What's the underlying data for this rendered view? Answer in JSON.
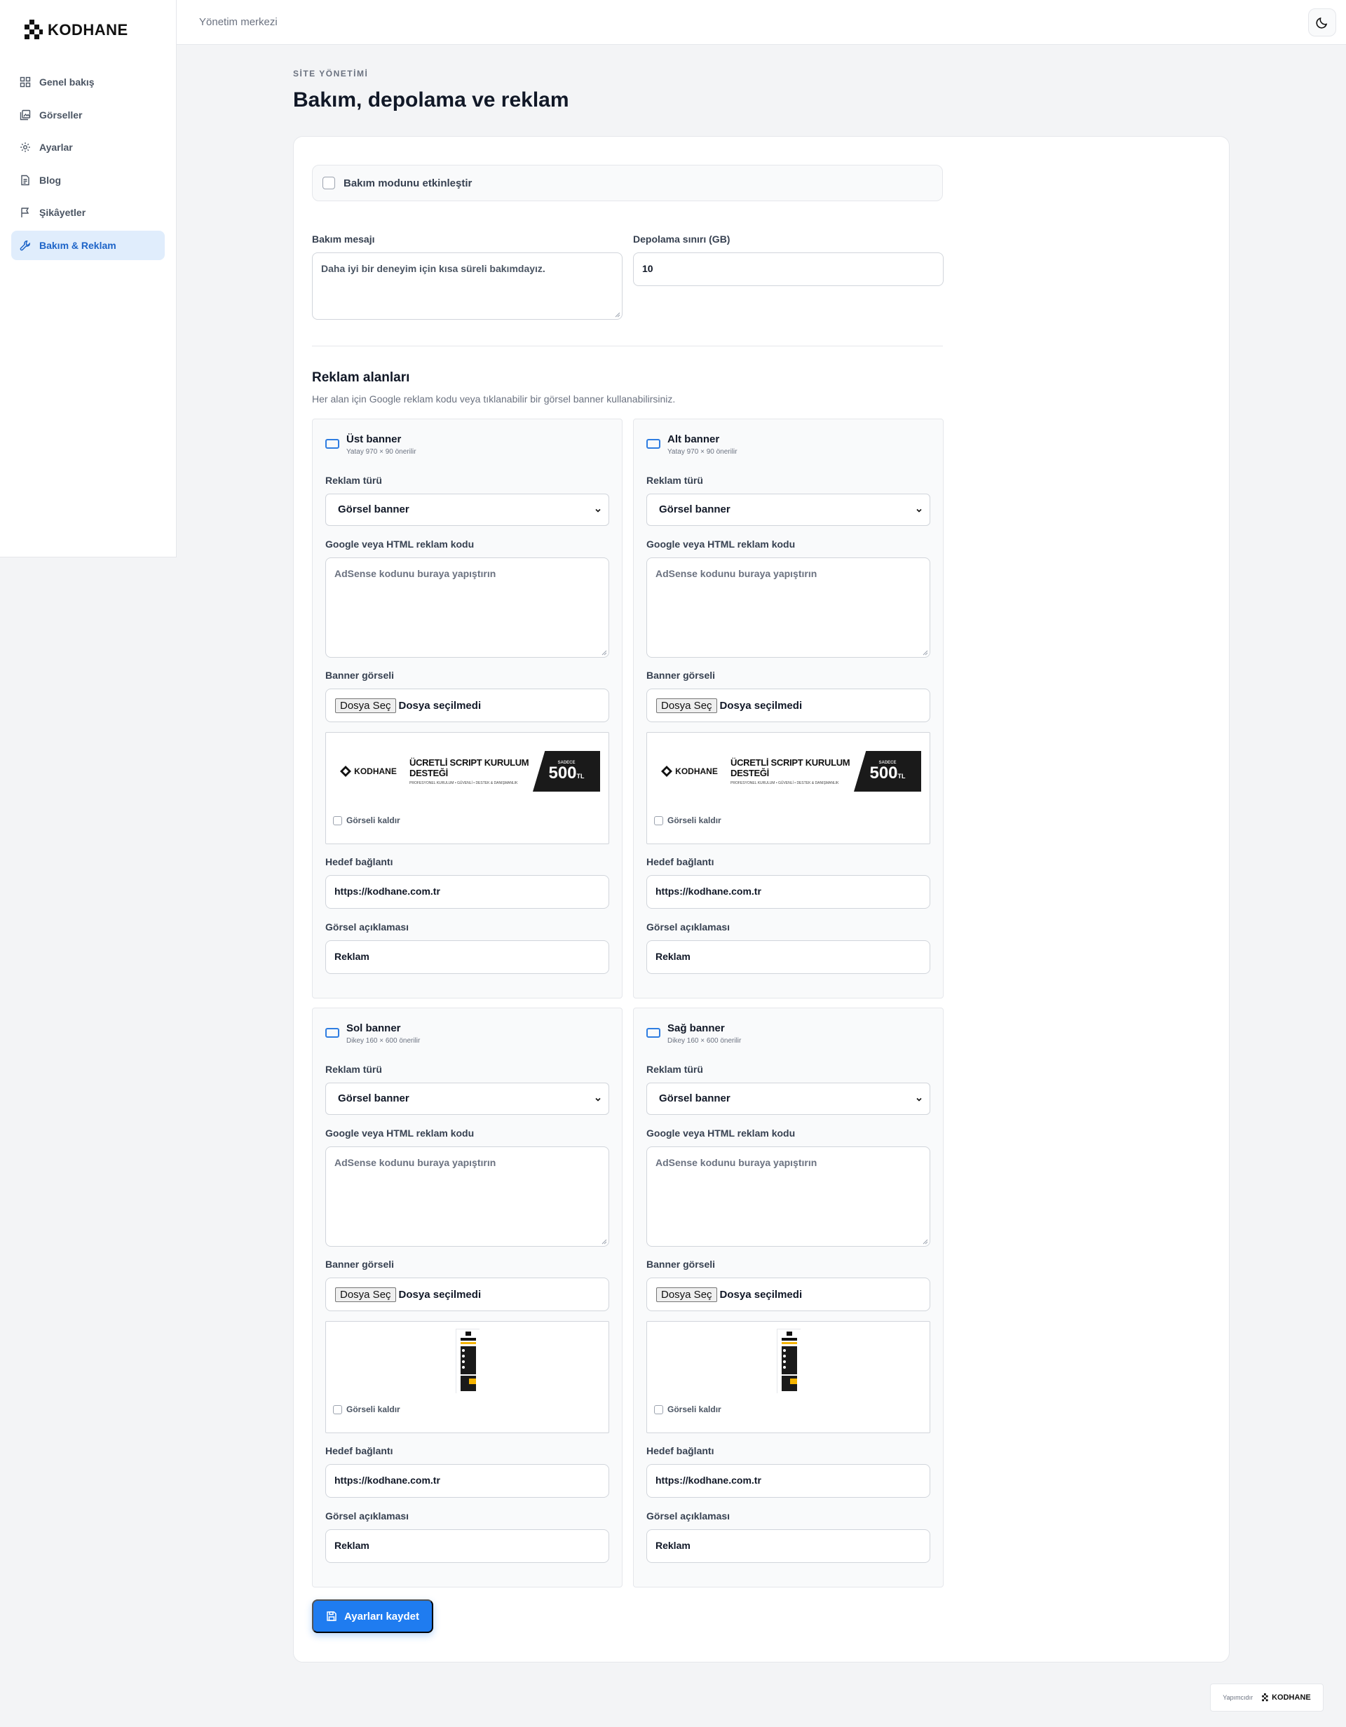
{
  "brand": {
    "name": "KODHANE"
  },
  "sidebar": {
    "items": [
      {
        "label": "Genel bakış",
        "icon": "dashboard-icon"
      },
      {
        "label": "Görseller",
        "icon": "images-icon"
      },
      {
        "label": "Ayarlar",
        "icon": "gear-icon"
      },
      {
        "label": "Blog",
        "icon": "document-icon"
      },
      {
        "label": "Şikâyetler",
        "icon": "flag-icon"
      },
      {
        "label": "Bakım & Reklam",
        "icon": "wrench-icon",
        "active": true
      }
    ]
  },
  "topbar": {
    "title": "Yönetim merkezi",
    "theme_icon": "moon-icon"
  },
  "page": {
    "eyebrow": "SİTE YÖNETİMİ",
    "title": "Bakım, depolama ve reklam"
  },
  "maintenance": {
    "toggle_label": "Bakım modunu etkinleştir",
    "message_label": "Bakım mesajı",
    "message_value": "Daha iyi bir deneyim için kısa süreli bakımdayız.",
    "storage_label": "Depolama sınırı (GB)",
    "storage_value": "10"
  },
  "ads": {
    "title": "Reklam alanları",
    "description": "Her alan için Google reklam kodu veya tıklanabilir bir görsel banner kullanabilirsiniz.",
    "labels": {
      "type": "Reklam türü",
      "code": "Google veya HTML reklam kodu",
      "code_placeholder": "AdSense kodunu buraya yapıştırın",
      "image": "Banner görseli",
      "file_button": "Dosya Seç",
      "file_status": "Dosya seçilmedi",
      "remove": "Görseli kaldır",
      "link": "Hedef bağlantı",
      "alt": "Görsel açıklaması"
    },
    "slots": [
      {
        "name": "Üst banner",
        "hint": "Yatay 970 × 90 önerilir",
        "type": "Görsel banner",
        "link": "https://kodhane.com.tr",
        "alt": "Reklam"
      },
      {
        "name": "Alt banner",
        "hint": "Yatay 970 × 90 önerilir",
        "type": "Görsel banner",
        "link": "https://kodhane.com.tr",
        "alt": "Reklam"
      },
      {
        "name": "Sol banner",
        "hint": "Dikey 160 × 600 önerilir",
        "type": "Görsel banner",
        "link": "https://kodhane.com.tr",
        "alt": "Reklam"
      },
      {
        "name": "Sağ banner",
        "hint": "Dikey 160 × 600 önerilir",
        "type": "Görsel banner",
        "link": "https://kodhane.com.tr",
        "alt": "Reklam"
      }
    ],
    "banner_image": {
      "brand": "KODHANE",
      "headline": "ÜCRETLİ SCRIPT KURULUM DESTEĞİ",
      "sub": "PROFESYONEL KURULUM • GÜVENLİ • DESTEK & DANIŞMANLIK",
      "price_label": "SADECE",
      "price": "500",
      "currency": "TL"
    }
  },
  "actions": {
    "save": "Ayarları kaydet"
  },
  "footer": {
    "credit_label": "Yapımcıdır",
    "credit_brand": "KODHANE"
  },
  "colors": {
    "accent": "#1f7cf0",
    "active_bg": "#e0edfc",
    "active_text": "#1d64c8"
  }
}
